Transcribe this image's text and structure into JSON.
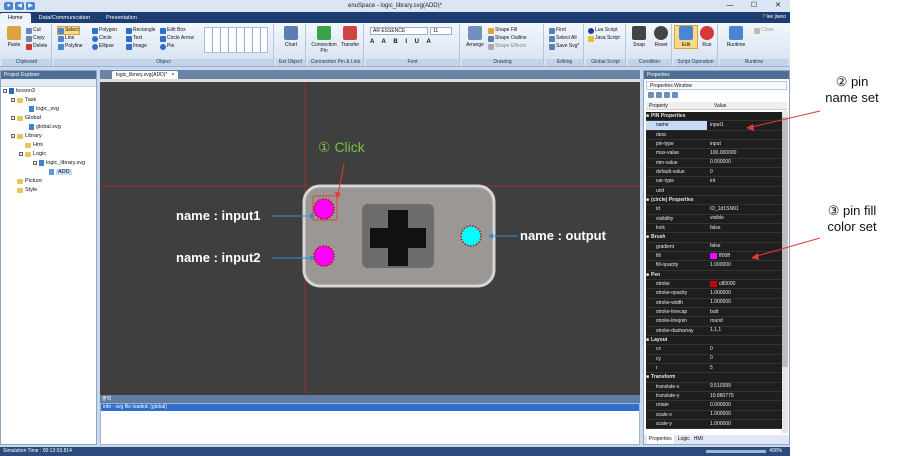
{
  "window": {
    "title": "enuSpace - logic_library.svg(ADD)*",
    "minimize": "—",
    "maximize": "☐",
    "close": "✕"
  },
  "ribbon_tabs": [
    "Home",
    "Data/Communication",
    "Presentation"
  ],
  "help": "?",
  "user": "lee jiwoo",
  "ribbon": {
    "clipboard": {
      "label": "Clipboard",
      "paste": "Paste",
      "cut": "Cut",
      "copy": "Copy",
      "delete": "Delete"
    },
    "object": {
      "label": "Object",
      "items": [
        "Select",
        "Line",
        "Polyline",
        "Polygon",
        "Circle",
        "Ellipse",
        "Rectangle",
        "Text",
        "Image",
        "Edit Box",
        "Circle Arrow",
        "Pie"
      ]
    },
    "ext_object": {
      "label": "Ext Object",
      "chart": "Chart"
    },
    "connection": {
      "label": "Connection Pin & Link",
      "pin": "Connection Pin",
      "transfer": "Transfer"
    },
    "font": {
      "label": "Font",
      "family": "AR ESSENCE",
      "size": "11"
    },
    "drawing": {
      "label": "Drawing",
      "arrange": "Arrange",
      "fill": "Shape Fill",
      "outline": "Shape Outline",
      "effects": "Shape Effects"
    },
    "editing": {
      "label": "Editing",
      "find": "Find",
      "select_all": "Select All",
      "save": "Save Svg*"
    },
    "global_script": {
      "label": "Global Script",
      "lua": "Lua Script",
      "java": "Java Script"
    },
    "condition": {
      "label": "Condition",
      "snap": "Snap",
      "reset": "Reset"
    },
    "script_op": {
      "label": "Script Operation",
      "edit": "Edit",
      "run": "Run"
    },
    "runtime": {
      "label": "Runtime",
      "runtime": "Runtime",
      "close": "Close"
    }
  },
  "explorer": {
    "title": "Project Explorer",
    "items": [
      {
        "label": "lesson3"
      },
      {
        "label": "Task"
      },
      {
        "label": "logic_svg"
      },
      {
        "label": "Global"
      },
      {
        "label": "global.svg"
      },
      {
        "label": "Library"
      },
      {
        "label": "Hmi"
      },
      {
        "label": "Logic"
      },
      {
        "label": "logic_library.svg"
      },
      {
        "label": "ADD"
      },
      {
        "label": "Picture"
      },
      {
        "label": "Style"
      }
    ]
  },
  "doc_tab": {
    "label": "logic_library.svg(ADD)*",
    "close": "×"
  },
  "canvas": {
    "input1_label": "name : input1",
    "input2_label": "name : input2",
    "output_label": "name : output"
  },
  "output": {
    "title": "출력",
    "line": "info - svg file loaded. (global)"
  },
  "properties": {
    "title": "Properties",
    "window": "Properties Window",
    "col_property": "Property",
    "col_value": "Value",
    "rows": [
      {
        "cat": "PIN Properties"
      },
      {
        "k": "name",
        "v": "input1"
      },
      {
        "k": "desc",
        "v": ""
      },
      {
        "k": "pin-type",
        "v": "input"
      },
      {
        "k": "max-value",
        "v": "100.000000"
      },
      {
        "k": "min-value",
        "v": "0.000000"
      },
      {
        "k": "default-value",
        "v": "0"
      },
      {
        "k": "var-type",
        "v": "int"
      },
      {
        "k": "unit",
        "v": ""
      },
      {
        "cat": "(circle) Properties"
      },
      {
        "k": "id",
        "v": "ID_1d1SN91"
      },
      {
        "k": "visibility",
        "v": "visible"
      },
      {
        "k": "lock",
        "v": "false"
      },
      {
        "cat": "Brush"
      },
      {
        "k": "gradient",
        "v": "false"
      },
      {
        "k": "fill",
        "v": "ff00ff",
        "swatch": "#ff00ff"
      },
      {
        "k": "fill-opacity",
        "v": "1.000000"
      },
      {
        "cat": "Pen"
      },
      {
        "k": "stroke",
        "v": "c80000",
        "swatch": "#c80000"
      },
      {
        "k": "stroke-opacity",
        "v": "1.000000"
      },
      {
        "k": "stroke-width",
        "v": "1.000000"
      },
      {
        "k": "stroke-linecap",
        "v": "butt"
      },
      {
        "k": "stroke-linejoin",
        "v": "round"
      },
      {
        "k": "stroke-dasharray",
        "v": "1,1,1"
      },
      {
        "cat": "Layout"
      },
      {
        "k": "cx",
        "v": "0"
      },
      {
        "k": "cy",
        "v": "0"
      },
      {
        "k": "r",
        "v": "5"
      },
      {
        "cat": "Transform"
      },
      {
        "k": "translate-x",
        "v": "9.510399"
      },
      {
        "k": "translate-y",
        "v": "10.880775"
      },
      {
        "k": "rotate",
        "v": "0.000000"
      },
      {
        "k": "scale-x",
        "v": "1.000000"
      },
      {
        "k": "scale-y",
        "v": "1.000000"
      }
    ],
    "tabs": [
      "Properties",
      "Logic",
      "HMI"
    ]
  },
  "status": {
    "text": "Simulation Time : 00:12:03.814",
    "zoom": "490%"
  },
  "annotations": {
    "click": "① Click",
    "pin_name": [
      "② pin",
      "name set"
    ],
    "pin_fill": [
      "③ pin fill",
      "color set"
    ]
  },
  "colors": {
    "input_fill": "#ff00ff",
    "output_fill": "#00ffff",
    "pin_stroke": "#c80000",
    "click_green": "#7ac142",
    "arrow_red": "#e53935"
  }
}
